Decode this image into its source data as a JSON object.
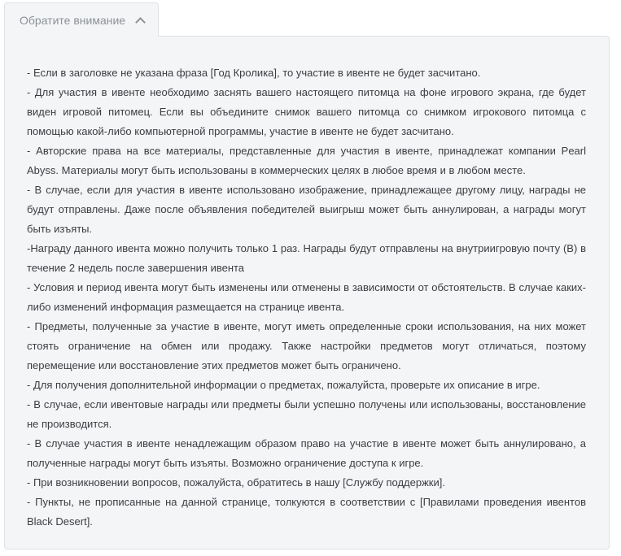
{
  "tab": {
    "label": "Обратите внимание",
    "icon": "chevron-up-icon"
  },
  "notes": [
    "- Если в заголовке не указана фраза [Год Кролика], то участие в ивенте не будет засчитано.",
    "- Для участия в ивенте необходимо заснять вашего настоящего питомца на фоне игрового экрана, где будет виден игровой питомец. Если вы объедините снимок вашего питомца со снимком игрокового питомца с помощью какой-либо компьютерной программы, участие в ивенте не будет засчитано.",
    "- Авторские права на все материалы, представленные для участия в ивенте, принадлежат компании Pearl Abyss. Материалы могут быть использованы в коммерческих целях в любое время и в любом месте.",
    "- В случае, если для участия в ивенте использовано изображение, принадлежащее другому лицу, награды не будут отправлены. Даже после объявления победителей выигрыш может быть аннулирован, а награды могут быть изъяты.",
    "-Награду данного ивента можно получить только 1 раз. Награды будут отправлены на внутриигровую почту (B) в течение 2 недель после завершения ивента",
    "- Условия и период ивента могут быть изменены или отменены в зависимости от обстоятельств. В случае каких-либо изменений информация размещается на странице ивента.",
    "- Предметы, полученные за участие в ивенте, могут иметь определенные сроки использования, на них может стоять ограничение на обмен или продажу. Также настройки предметов могут отличаться, поэтому перемещение или восстановление этих предметов может быть ограничено.",
    "- Для получения дополнительной информации о предметах, пожалуйста, проверьте их описание в игре.",
    "- В случае, если ивентовые награды или предметы были успешно получены или использованы, восстановление не производится.",
    "- В случае участия в ивенте ненадлежащим образом право на участие в ивенте может быть аннулировано, а полученные награды могут быть изъяты. Возможно ограничение доступа к игре.",
    "- При возникновении вопросов, пожалуйста, обратитесь в нашу [Службу поддержки].",
    "- Пункты, не прописанные на данной странице, толкуются в соответствии с [Правилами проведения ивентов Black Desert]."
  ]
}
